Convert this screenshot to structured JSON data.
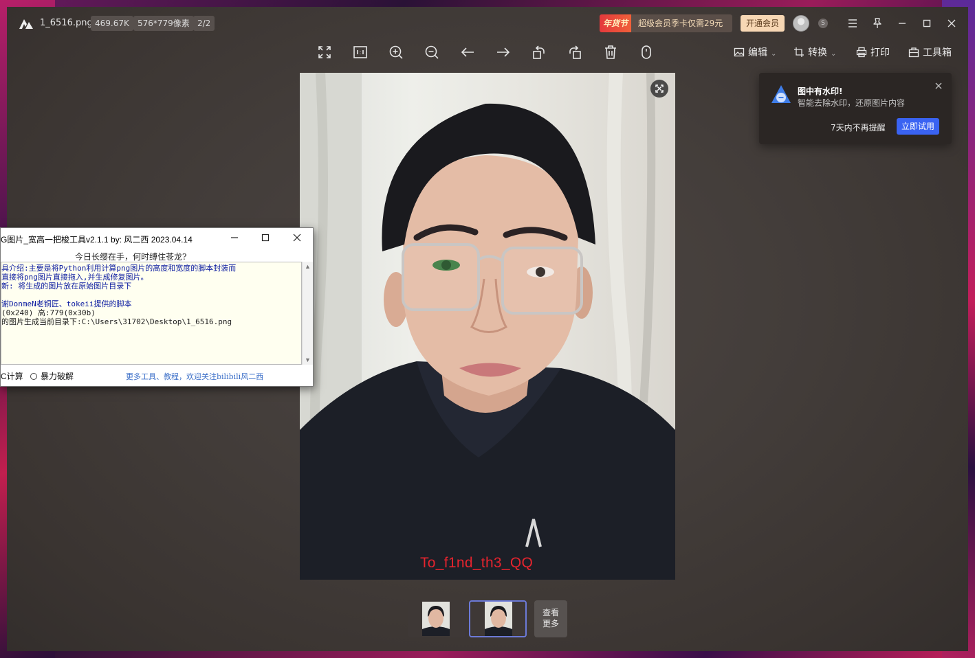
{
  "titlebar": {
    "filename": "1_6516.png",
    "file_size": "469.67K",
    "dimensions": "576*779像素",
    "page_index": "2/2",
    "promo_tag": "年货节",
    "promo_text": "超级会员季卡仅需29元",
    "vip_button": "开通会员"
  },
  "toolbar": {
    "edit": "编辑",
    "convert": "转换",
    "print": "打印",
    "toolbox": "工具箱"
  },
  "image": {
    "watermark_text": "To_f1nd_th3_QQ"
  },
  "watermark_popup": {
    "title": "图中有水印!",
    "description": "智能去除水印，还原图片内容",
    "dismiss": "7天内不再提醒",
    "try_button": "立即试用"
  },
  "thumbnails": {
    "more_line1": "查看",
    "more_line2": "更多"
  },
  "tool_window": {
    "title": "G图片_宽高一把梭工具v2.1.1    by: 风二西 2023.04.14",
    "motto": "今日长缨在手，何时缚住苍龙?",
    "lines": [
      "具介绍:主要是将Python利用计算png图片的高度和宽度的脚本封装而",
      "直接将png图片直接拖入,并生成修复图片。",
      "新: 将生成的图片放在原始图片目录下",
      "",
      "谢DonmeN老铜匠、tokeii提供的脚本",
      "(0x240)    高:779(0x30b)",
      "的图片生成当前目录下:C:\\Users\\31702\\Desktop\\1_6516.png"
    ],
    "option_crc": "C计算",
    "option_brute": "暴力破解",
    "footer_link": "更多工具、教程，欢迎关注bilibili风二西"
  },
  "colors": {
    "viewer_bg": "#433d3a",
    "vip_button": "#f7d7b4",
    "popup_button": "#3a63f2",
    "watermark_red": "#e6242e",
    "thumb_active_border": "#6c7ad8"
  }
}
